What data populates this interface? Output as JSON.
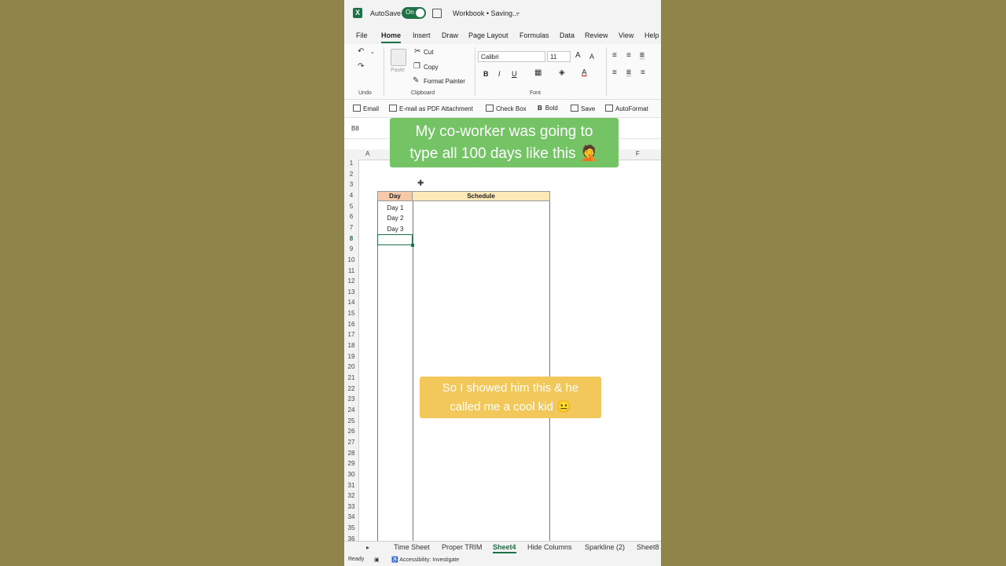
{
  "titlebar": {
    "autosave_label": "AutoSave",
    "autosave_state": "On",
    "workbook_title": "Workbook • Saving...",
    "chevron": "⌄"
  },
  "menu_tabs": [
    "File",
    "Home",
    "Insert",
    "Draw",
    "Page Layout",
    "Formulas",
    "Data",
    "Review",
    "View",
    "Help"
  ],
  "ribbon": {
    "undo_label": "Undo",
    "paste_label": "Paste",
    "cut_label": "Cut",
    "copy_label": "Copy",
    "format_painter_label": "Format Painter",
    "clipboard_label": "Clipboard",
    "font_name": "Calibri",
    "font_size": "11",
    "font_label": "Font",
    "bold": "B",
    "italic": "I",
    "underline": "U"
  },
  "quick_access": [
    "Email",
    "E-mail as PDF Attachment",
    "Check Box",
    "Bold",
    "Save",
    "AutoFormat"
  ],
  "formula_bar": {
    "name_box": "B8"
  },
  "columns": [
    "A",
    "F"
  ],
  "rows": [
    "1",
    "2",
    "3",
    "4",
    "5",
    "6",
    "7",
    "8",
    "9",
    "10",
    "11",
    "12",
    "13",
    "14",
    "15",
    "16",
    "17",
    "18",
    "19",
    "20",
    "21",
    "22",
    "23",
    "24",
    "25",
    "26",
    "27",
    "28",
    "29",
    "30",
    "31",
    "32",
    "33",
    "34",
    "35",
    "36"
  ],
  "table": {
    "header_day": "Day",
    "header_schedule": "Schedule",
    "days": [
      "Day 1",
      "Day 2",
      "Day 3"
    ]
  },
  "sheet_tabs": [
    "Time Sheet",
    "Proper TRIM",
    "Sheet4",
    "Hide Columns",
    "Sparkline (2)",
    "Sheet8"
  ],
  "status": {
    "ready": "Ready",
    "accessibility": "Accessibility: Investigate"
  },
  "captions": {
    "top_line1": "My co-worker was going to",
    "top_line2": "type all 100 days like this 🤦",
    "bottom_line1": "So I showed him this & he",
    "bottom_line2": "called me a cool kid 😐"
  },
  "colors": {
    "excel_green": "#1e7145",
    "caption_green": "#74c365",
    "caption_yellow": "#f3c85a",
    "background": "#8f844a"
  }
}
